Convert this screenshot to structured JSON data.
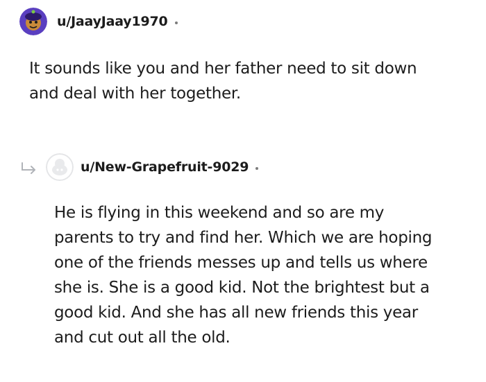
{
  "comments": [
    {
      "username": "u/JaayJaay1970",
      "avatar": "custom-purple-avatar",
      "body": "It sounds like you and her father need to sit down\nand deal with her together."
    },
    {
      "username": "u/New-Grapefruit-9029",
      "avatar": "default-snoo-avatar",
      "reply_icon": "reply-arrow-icon",
      "body": "He is flying in this weekend and so are my\nparents to try and find her. Which we are hoping\none of the friends messes up and tells us where\nshe is. She is a good kid. Not the brightest but a\ngood kid. And she has all new friends this year\nand cut out all the old."
    }
  ],
  "colors": {
    "text": "#1c1c1c",
    "meta": "#7c7c7c",
    "avatar_purple": "#5a3fc0",
    "avatar_default": "#e9eaec"
  }
}
